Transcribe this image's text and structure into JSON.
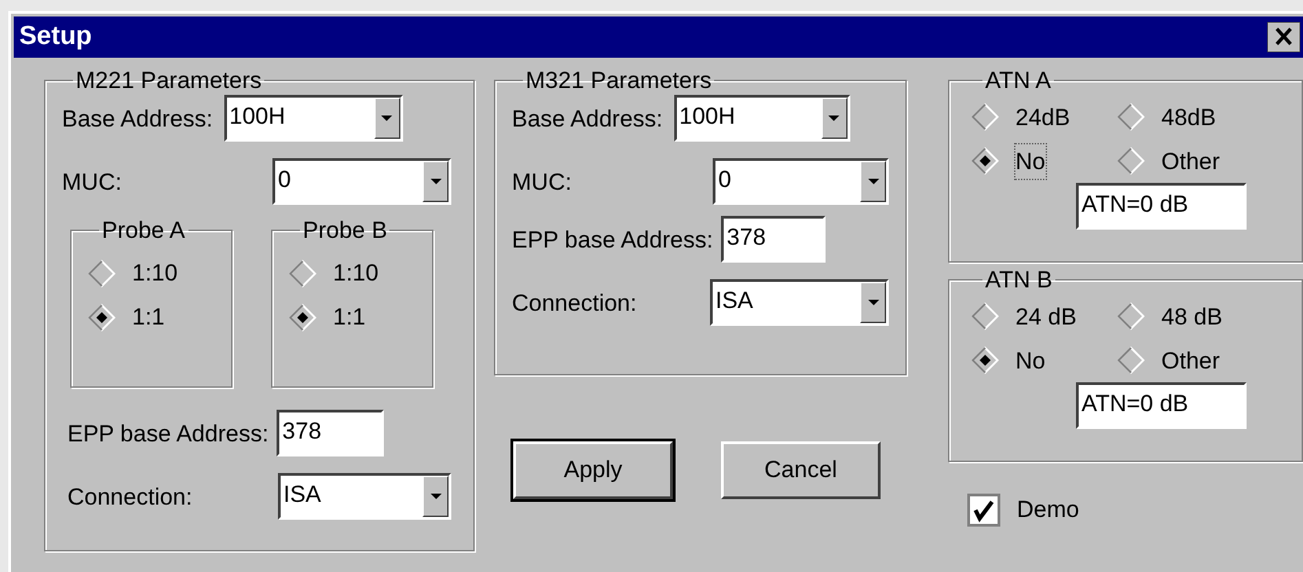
{
  "window": {
    "title": "Setup"
  },
  "m221": {
    "title": "M221 Parameters",
    "base_address": {
      "label": "Base Address:",
      "value": "100H"
    },
    "muc": {
      "label": "MUC:",
      "value": "0"
    },
    "probes": [
      {
        "title": "Probe A",
        "options": [
          {
            "label": "1:10",
            "selected": false
          },
          {
            "label": "1:1",
            "selected": true
          }
        ]
      },
      {
        "title": "Probe B",
        "options": [
          {
            "label": "1:10",
            "selected": false
          },
          {
            "label": "1:1",
            "selected": true
          }
        ]
      }
    ],
    "epp": {
      "label": "EPP base Address:",
      "value": "378"
    },
    "connection": {
      "label": "Connection:",
      "value": "ISA"
    }
  },
  "m321": {
    "title": "M321 Parameters",
    "base_address": {
      "label": "Base Address:",
      "value": "100H"
    },
    "muc": {
      "label": "MUC:",
      "value": "0"
    },
    "epp": {
      "label": "EPP base Address:",
      "value": "378"
    },
    "connection": {
      "label": "Connection:",
      "value": "ISA"
    }
  },
  "atn": [
    {
      "title": "ATN A",
      "options": [
        {
          "label": "24dB",
          "selected": false,
          "focused": false
        },
        {
          "label": "48dB",
          "selected": false,
          "focused": false
        },
        {
          "label": "No",
          "selected": true,
          "focused": true
        },
        {
          "label": "Other",
          "selected": false,
          "focused": false
        }
      ],
      "value": "ATN=0 dB"
    },
    {
      "title": "ATN B",
      "options": [
        {
          "label": "24 dB",
          "selected": false,
          "focused": false
        },
        {
          "label": "48 dB",
          "selected": false,
          "focused": false
        },
        {
          "label": "No",
          "selected": true,
          "focused": false
        },
        {
          "label": "Other",
          "selected": false,
          "focused": false
        }
      ],
      "value": "ATN=0 dB"
    }
  ],
  "buttons": [
    {
      "label": "Apply",
      "default": true
    },
    {
      "label": "Cancel",
      "default": false
    }
  ],
  "demo": {
    "label": "Demo",
    "checked": true
  }
}
